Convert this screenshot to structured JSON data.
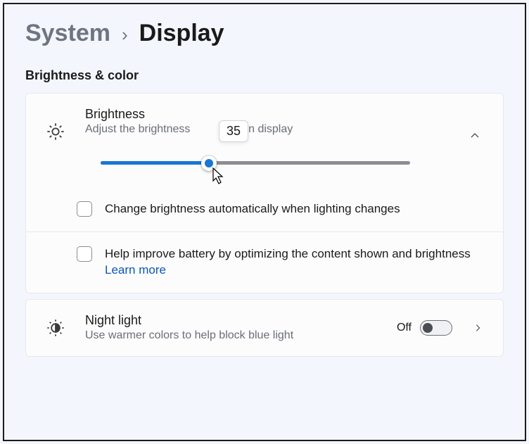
{
  "breadcrumb": {
    "parent": "System",
    "current": "Display"
  },
  "section": {
    "title": "Brightness & color"
  },
  "brightness": {
    "title": "Brightness",
    "subtitle_before": "Adjust the brightness",
    "subtitle_after": "built-in display",
    "value": 35,
    "value_text": "35",
    "slider_percent": 35
  },
  "options": {
    "auto_label": "Change brightness automatically when lighting changes",
    "battery_label": "Help improve battery by optimizing the content shown and brightness",
    "learn_more": "Learn more"
  },
  "nightlight": {
    "title": "Night light",
    "subtitle": "Use warmer colors to help block blue light",
    "state": "Off"
  }
}
